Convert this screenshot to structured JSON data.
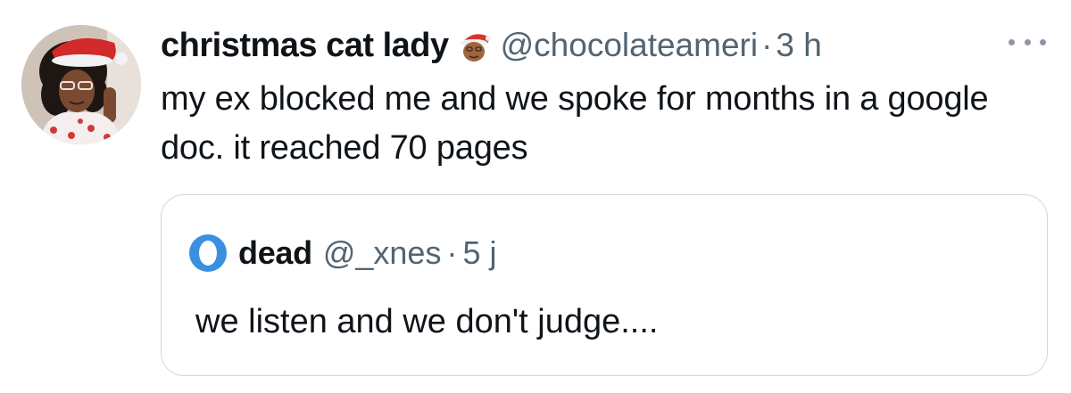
{
  "tweet": {
    "display_name": "christmas cat lady",
    "name_emoji_icon": "santa-face-emoji",
    "handle": "@chocolateameri",
    "separator": "·",
    "time": "3 h",
    "text": "my ex blocked me and we spoke for months in a google doc. it reached 70 pages"
  },
  "quote": {
    "display_name": "dead",
    "handle": "@_xnes",
    "separator": "·",
    "time": "5 j",
    "text": "we listen and we don't judge...."
  },
  "colors": {
    "text_primary": "#0f1419",
    "text_secondary": "#536471",
    "border": "#cfd9de",
    "quote_avatar_blue": "#3b8fe0"
  }
}
